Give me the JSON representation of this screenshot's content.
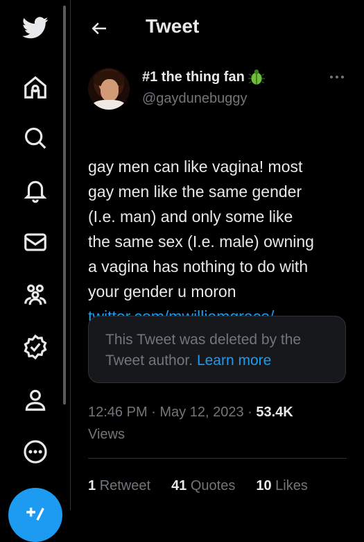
{
  "header": {
    "title": "Tweet"
  },
  "author": {
    "display_name": "#1 the thing fan",
    "handle": "@gaydunebuggy"
  },
  "tweet": {
    "text": "gay men can like vagina! most\ngay men like the same gender\n(I.e. man) and only some like\nthe same sex (I.e. male) owning\na vagina has nothing to do with\nyour gender u moron",
    "link": "twitter.com/mwilliamgrace/..."
  },
  "quoted": {
    "text": "This Tweet was deleted by the Tweet author.",
    "learn_more": "Learn more"
  },
  "meta": {
    "time": "12:46 PM",
    "date": "May 12, 2023",
    "views_count": "53.4K",
    "views_label": "Views"
  },
  "stats": {
    "retweets_count": "1",
    "retweets_label": "Retweet",
    "quotes_count": "41",
    "quotes_label": "Quotes",
    "likes_count": "10",
    "likes_label": "Likes"
  },
  "nav_icons": [
    "twitter-logo-icon",
    "home-icon",
    "search-icon",
    "bell-icon",
    "mail-icon",
    "communities-icon",
    "verified-icon",
    "profile-icon",
    "more-circle-icon",
    "compose-icon"
  ],
  "colors": {
    "accent": "#1d9bf0",
    "background": "#000000",
    "text": "#e7e9ea",
    "muted": "#71767b"
  }
}
